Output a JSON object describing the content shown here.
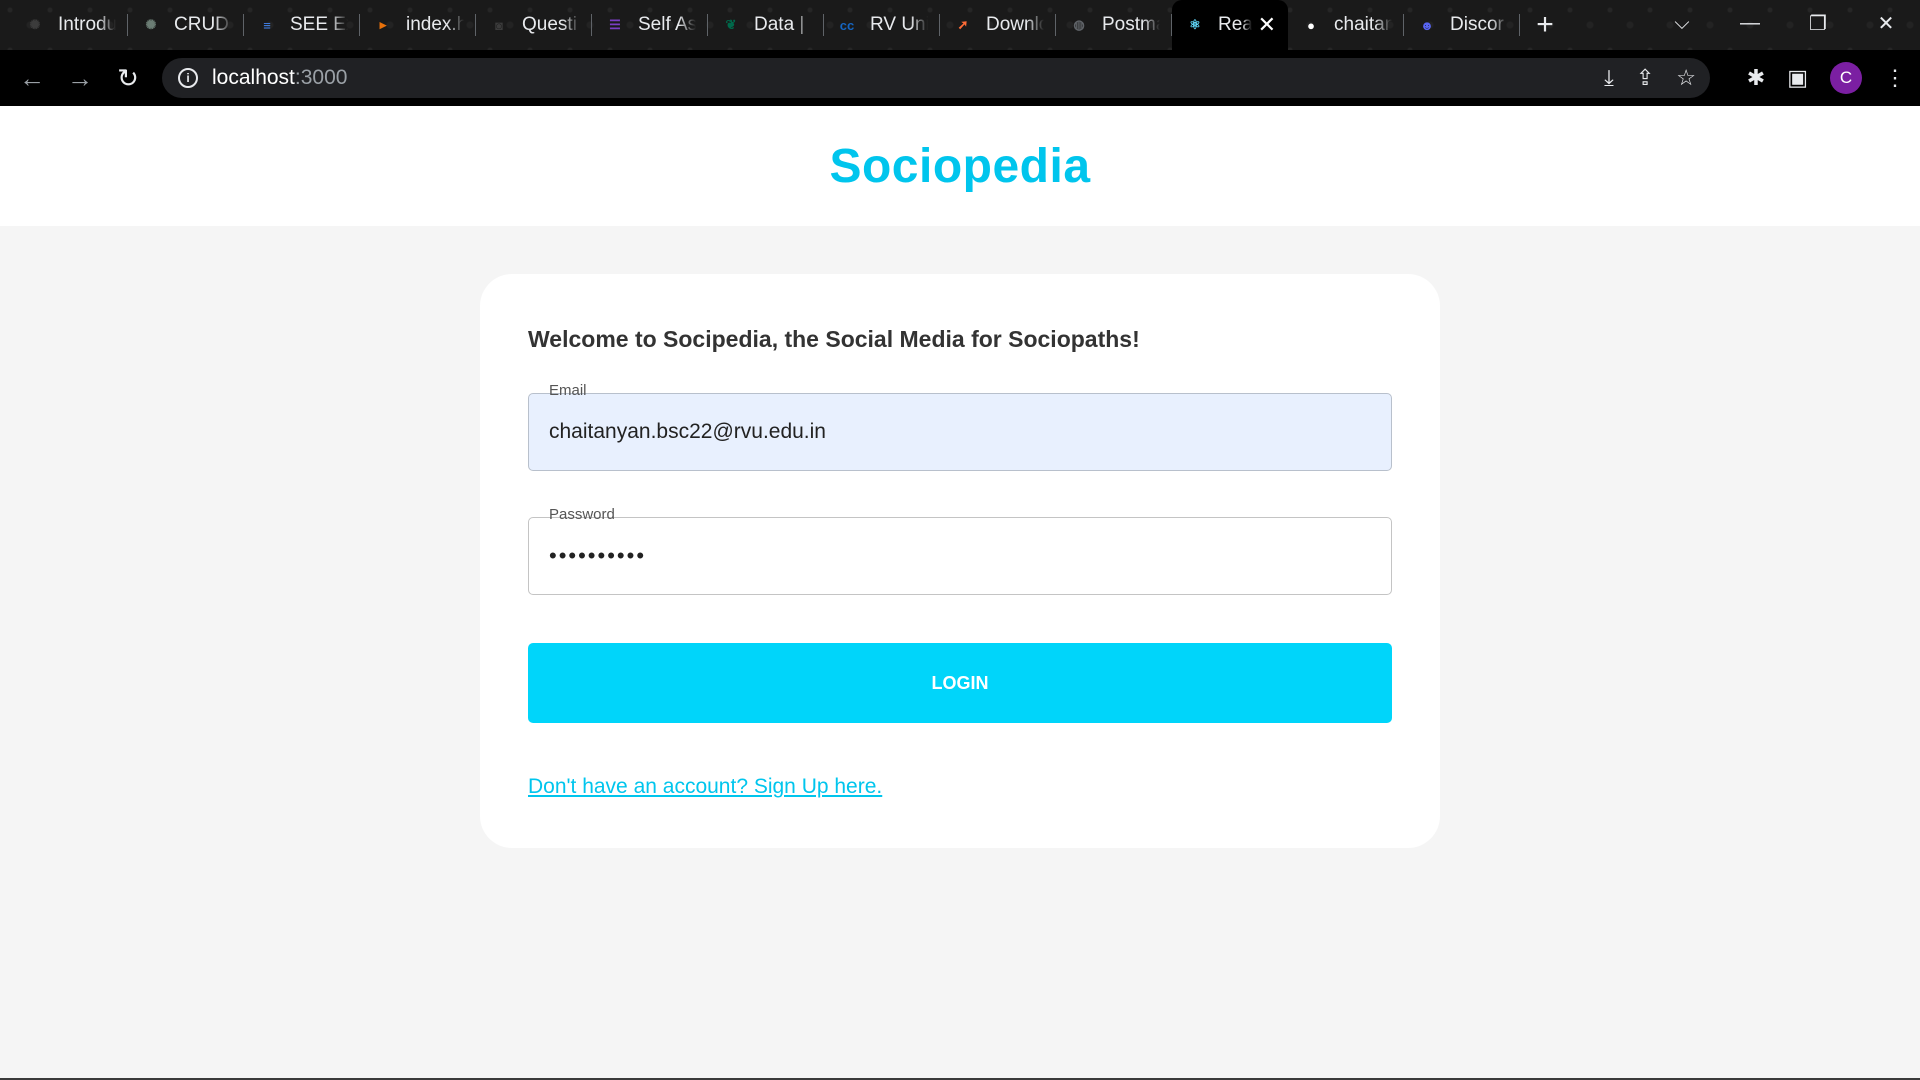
{
  "browser": {
    "tabs": [
      {
        "label": "Introdu",
        "icon": "openai-icon",
        "color": "#3c3c3c"
      },
      {
        "label": "CRUD",
        "icon": "openai-icon",
        "color": "#6b7d74"
      },
      {
        "label": "SEE Exa",
        "icon": "google-docs-icon",
        "color": "#4285f4"
      },
      {
        "label": "index.h",
        "icon": "file-icon",
        "color": "#e8710a"
      },
      {
        "label": "Questi",
        "icon": "contact-icon",
        "color": "#3c3c3c"
      },
      {
        "label": "Self As",
        "icon": "forms-icon",
        "color": "#7b3fc4"
      },
      {
        "label": "Data | ",
        "icon": "mongodb-icon",
        "color": "#00684a"
      },
      {
        "label": "RV Uni",
        "icon": "cc-icon",
        "color": "#1565c0"
      },
      {
        "label": "Downlo",
        "icon": "postman-icon",
        "color": "#ff6c37"
      },
      {
        "label": "Postma",
        "icon": "globe-icon",
        "color": "#5f6368"
      },
      {
        "label": "Rea",
        "icon": "react-icon",
        "color": "#61dafb",
        "active": true
      },
      {
        "label": "chaitan",
        "icon": "github-icon",
        "color": "#ffffff"
      },
      {
        "label": "Discor",
        "icon": "discord-icon",
        "color": "#5865f2"
      }
    ],
    "new_tab": "+",
    "address": {
      "host": "localhost",
      "port": ":3000"
    },
    "profile_initial": "C"
  },
  "app": {
    "brand": "Sociopedia",
    "welcome": "Welcome to Socipedia, the Social Media for Sociopaths!",
    "email": {
      "label": "Email",
      "value": "chaitanyan.bsc22@rvu.edu.in"
    },
    "password": {
      "label": "Password",
      "value": "••••••••••"
    },
    "login_label": "LOGIN",
    "signup_link": "Don't have an account? Sign Up here."
  },
  "colors": {
    "brand": "#00c5ed",
    "button": "#00d5fa",
    "autofill": "#e8f0fe"
  }
}
